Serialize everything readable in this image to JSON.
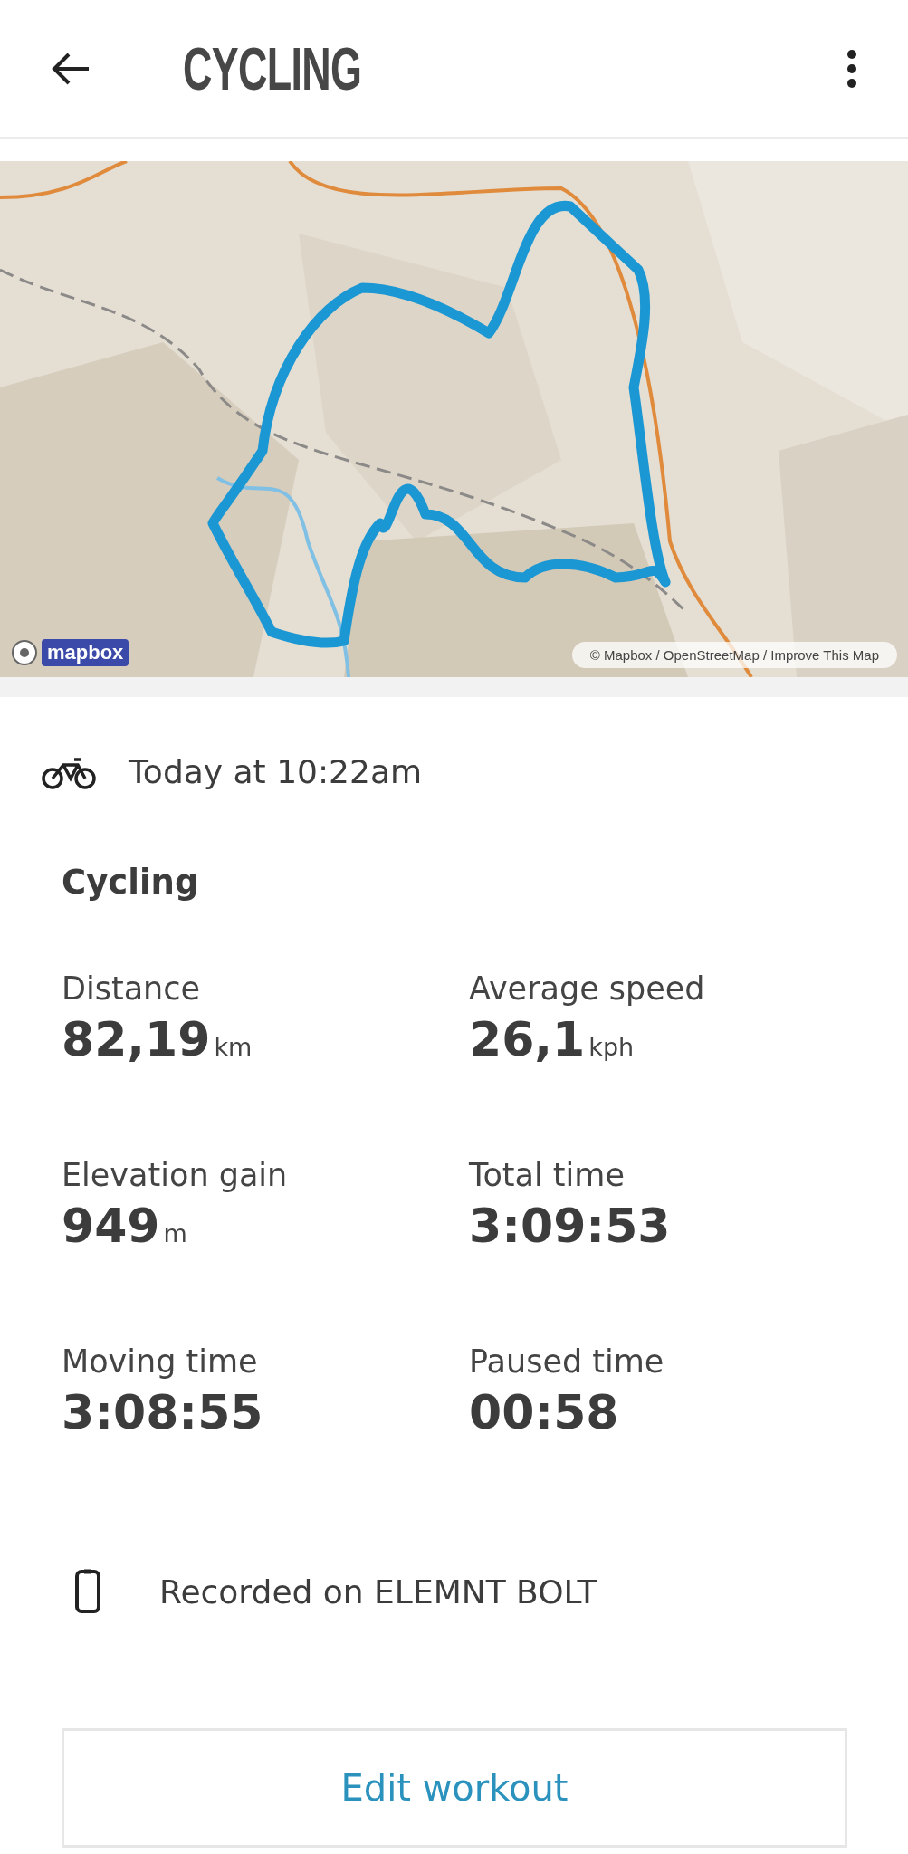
{
  "header": {
    "title": "CYCLING"
  },
  "map": {
    "logo": "mapbox",
    "attribution": "© Mapbox / OpenStreetMap / Improve This Map"
  },
  "workout": {
    "date": "Today at 10:22am",
    "heading": "Cycling",
    "stats": [
      {
        "label": "Distance",
        "value": "82,19",
        "unit": "km"
      },
      {
        "label": "Average speed",
        "value": "26,1",
        "unit": "kph"
      },
      {
        "label": "Elevation gain",
        "value": "949",
        "unit": "m"
      },
      {
        "label": "Total time",
        "value": "3:09:53"
      },
      {
        "label": "Moving time",
        "value": "3:08:55"
      },
      {
        "label": "Paused time",
        "value": "00:58"
      }
    ],
    "device": "Recorded on ELEMNT BOLT"
  },
  "button": "Edit workout"
}
